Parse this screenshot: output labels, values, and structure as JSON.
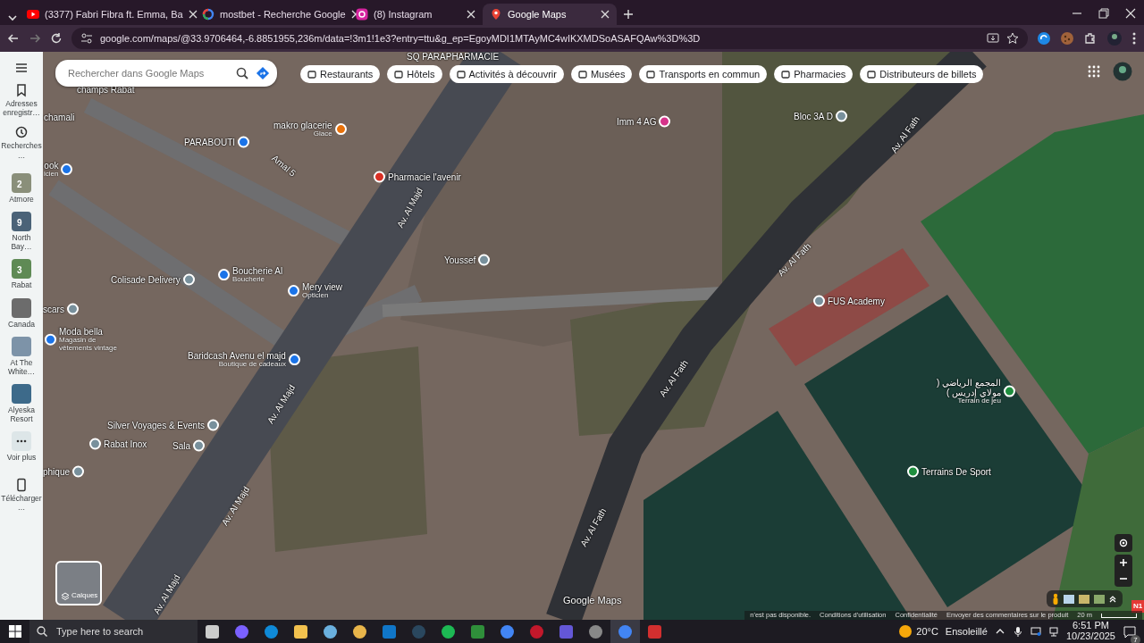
{
  "browser": {
    "tabs": [
      {
        "title": "(3377) Fabri Fibra ft. Emma, Ba",
        "kind": "video",
        "selected": false
      },
      {
        "title": "mostbet - Recherche Google",
        "kind": "search",
        "selected": false
      },
      {
        "title": "(8) Instagram",
        "kind": "photo",
        "selected": false
      },
      {
        "title": "Google Maps",
        "kind": "map",
        "selected": true
      }
    ],
    "url": "google.com/maps/@33.9706464,-6.8851955,236m/data=!3m1!1e3?entry=ttu&g_ep=EgoyMDI1MTAyMC4wIKXMDSoASAFQAw%3D%3D"
  },
  "sidebar": {
    "items": [
      {
        "kind": "saved",
        "label": "Adresses enregistr…"
      },
      {
        "kind": "recent",
        "label": "Recherches…"
      },
      {
        "kind": "list",
        "label": "Atmore",
        "badge": "2"
      },
      {
        "kind": "list",
        "label": "North Bay…",
        "badge": "9"
      },
      {
        "kind": "list",
        "label": "Rabat",
        "badge": "3"
      },
      {
        "kind": "list",
        "label": "Canada"
      },
      {
        "kind": "list",
        "label": "At The White…"
      },
      {
        "kind": "list",
        "label": "Alyeska Resort"
      },
      {
        "kind": "more",
        "label": "Voir plus"
      },
      {
        "kind": "download",
        "label": "Télécharger…"
      }
    ]
  },
  "search": {
    "placeholder": "Rechercher dans Google Maps"
  },
  "chips": [
    "Restaurants",
    "Hôtels",
    "Activités à découvrir",
    "Musées",
    "Transports en commun",
    "Pharmacies",
    "Distributeurs de billets"
  ],
  "map": {
    "places": [
      {
        "name": "SQ PARAPHARMACIE"
      },
      {
        "name": "champs Rabat"
      },
      {
        "name": "chamali"
      },
      {
        "name": "ook",
        "subtitle": "icien",
        "color": "#1a73e8"
      },
      {
        "name": "PARABOUTI",
        "color": "#1a73e8"
      },
      {
        "name": "makro glacerie",
        "subtitle": "Glace",
        "color": "#e8710a"
      },
      {
        "name": "Pharmacie l'avenir",
        "color": "#d93025"
      },
      {
        "name": "Imm 4 AG",
        "color": "#d6338a"
      },
      {
        "name": "Bloc 3A D",
        "color": "#78909c"
      },
      {
        "name": "Youssef",
        "color": "#78909c"
      },
      {
        "name": "FUS Academy",
        "color": "#78909c"
      },
      {
        "name": "Colisade Delivery",
        "color": "#78909c"
      },
      {
        "name": "Boucherie Al",
        "subtitle": "Boucherie",
        "color": "#1a73e8"
      },
      {
        "name": "Mery view",
        "subtitle": "Opticien",
        "color": "#1a73e8"
      },
      {
        "name": "scars",
        "color": "#78909c"
      },
      {
        "name": "Moda bella",
        "subtitle": "Magasin de vêtements vintage",
        "color": "#1a73e8"
      },
      {
        "name": "Baridcash Avenu el majd",
        "subtitle": "Boutique de cadeaux",
        "color": "#1a73e8"
      },
      {
        "name": "المجمع الرياضي ( مولاي إدريس )",
        "subtitle": "Terrain de jeu",
        "color": "#1e8e3e"
      },
      {
        "name": "Silver Voyages & Events",
        "color": "#78909c"
      },
      {
        "name": "Rabat Inox",
        "color": "#78909c"
      },
      {
        "name": "Sala",
        "color": "#78909c"
      },
      {
        "name": "phique",
        "color": "#78909c"
      },
      {
        "name": "Terrains De Sport",
        "color": "#1e8e3e"
      }
    ],
    "roads": [
      "Amal 5",
      "Av. Al Majd",
      "Av. Al Fath",
      "Av. Al Fath",
      "Av. Al Majd",
      "Av. Al Fath",
      "Av. Al Majd",
      "Av. Al Fath",
      "Av. Al Majd"
    ],
    "layers_label": "Calques",
    "logo": "Google Maps",
    "footer": [
      "n'est pas disponible.",
      "Conditions d'utilisation",
      "Confidentialité",
      "Envoyer des commentaires sur le produit"
    ],
    "scale": "20 m",
    "corner_badge": "N1"
  },
  "taskbar": {
    "search_placeholder": "Type here to search",
    "apps": [
      {
        "active": false
      },
      {
        "active": false
      },
      {
        "active": false
      },
      {
        "active": false
      },
      {
        "active": false
      },
      {
        "active": false
      },
      {
        "active": false
      },
      {
        "active": false
      },
      {
        "active": false
      },
      {
        "active": false
      },
      {
        "active": false
      },
      {
        "active": false
      },
      {
        "active": false
      },
      {
        "active": false
      },
      {
        "active": true
      },
      {
        "active": false
      }
    ],
    "temperature": "20°C",
    "weather": "Ensoleillé",
    "time": "6:51 PM",
    "date": "10/23/2025",
    "notifications": "7"
  }
}
